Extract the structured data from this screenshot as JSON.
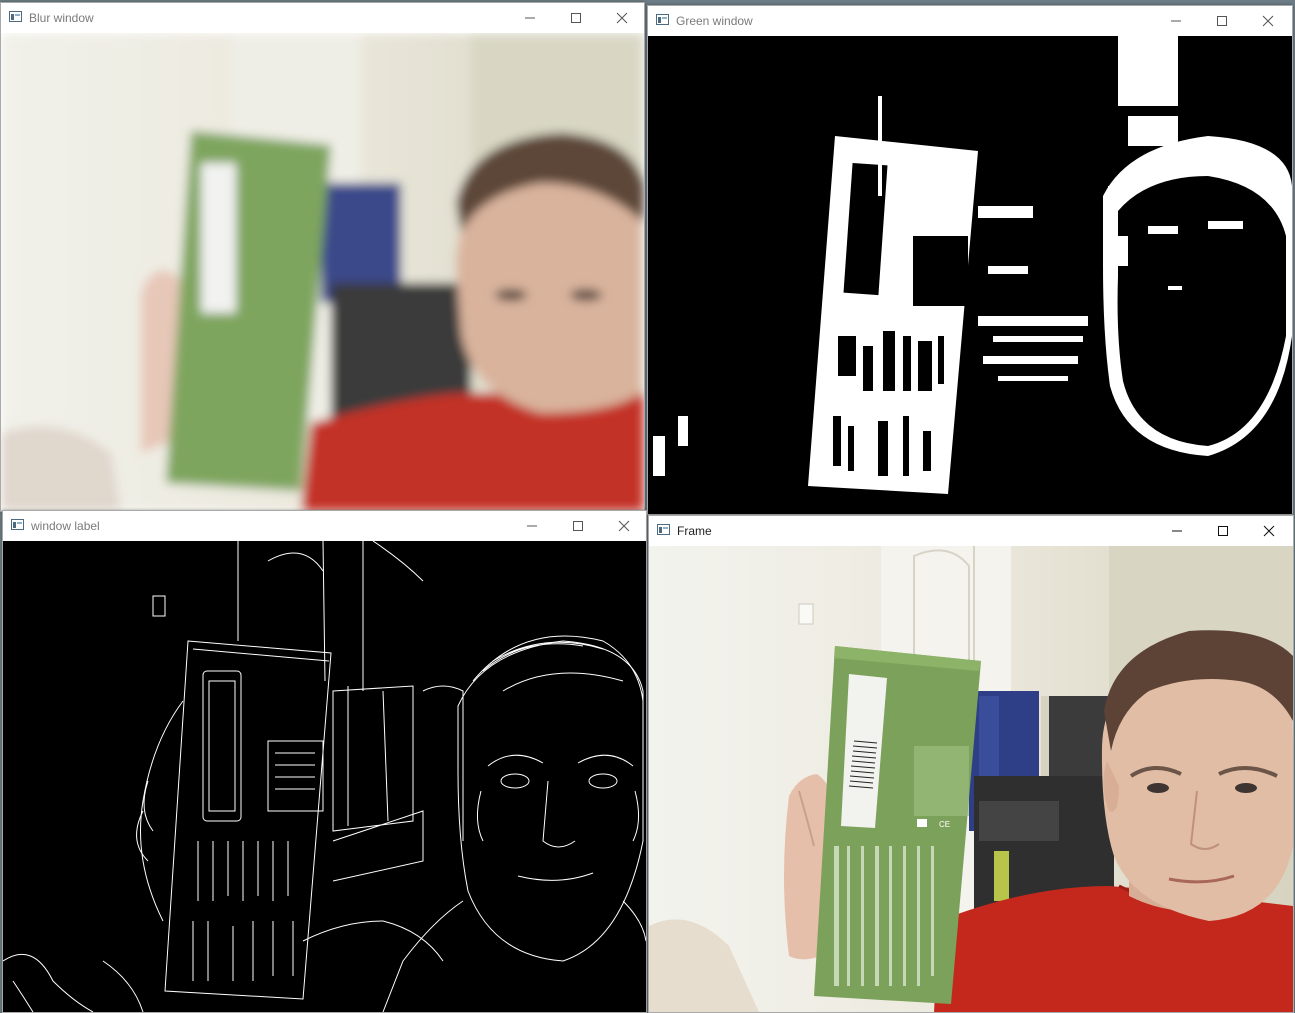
{
  "windows": [
    {
      "title": "Blur window",
      "content": "blurred-webcam-frame",
      "active": false
    },
    {
      "title": "Green window",
      "content": "green-threshold-mask",
      "active": false
    },
    {
      "title": "window label",
      "content": "canny-edge-map",
      "active": false
    },
    {
      "title": "Frame",
      "content": "webcam-frame",
      "active": true
    }
  ],
  "controls": {
    "minimize_icon": "minimize-icon",
    "maximize_icon": "maximize-icon",
    "close_icon": "close-icon"
  },
  "colors": {
    "box_green": "#7aa35a",
    "shirt_red": "#c4281c",
    "wall": "#e8e6dc",
    "mask_black": "#000000",
    "mask_white": "#ffffff"
  }
}
